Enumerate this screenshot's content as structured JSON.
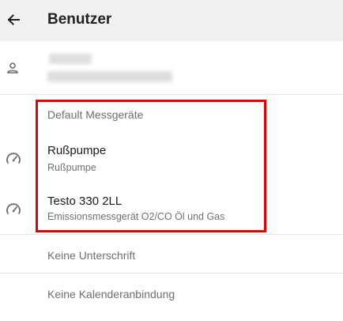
{
  "header": {
    "title": "Benutzer",
    "back_icon": "arrow-left-icon"
  },
  "user": {
    "icon": "person-icon"
  },
  "devices": {
    "section_label": "Default Messgeräte",
    "icon": "gauge-icon",
    "items": [
      {
        "title": "Rußpumpe",
        "subtitle": "Rußpumpe"
      },
      {
        "title": "Testo 330 2LL",
        "subtitle": "Emissionsmessgerät O2/CO Öl und Gas"
      }
    ]
  },
  "signature": {
    "label": "Keine Unterschrift"
  },
  "calendar": {
    "label": "Keine Kalenderanbindung"
  },
  "colors": {
    "highlight_border": "#e00000",
    "header_background": "#f1f1f1"
  }
}
